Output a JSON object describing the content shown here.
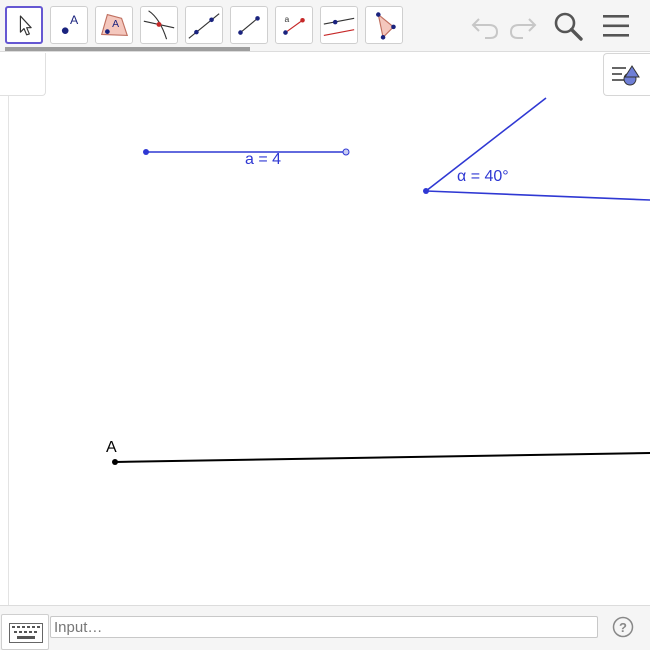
{
  "toolbar": {
    "tools": [
      {
        "name": "move",
        "selected": true
      },
      {
        "name": "point",
        "glyph": "A"
      },
      {
        "name": "polygon",
        "glyph": "A"
      },
      {
        "name": "perpendicular-line"
      },
      {
        "name": "line"
      },
      {
        "name": "segment"
      },
      {
        "name": "segment-with-given-length",
        "glyph": "a"
      },
      {
        "name": "parallel-line"
      },
      {
        "name": "polygon-vertices"
      }
    ],
    "icons": [
      "undo-icon",
      "redo-icon",
      "search-icon",
      "menu-icon"
    ]
  },
  "graphics": {
    "segment_label": "a = 4",
    "angle_label": "α = 40°",
    "point_label": "A"
  },
  "input": {
    "placeholder": "Input…"
  },
  "colors": {
    "object_blue": "#2f38d3",
    "selected_tool_border": "#6557d2",
    "black_segment": "#000000"
  }
}
